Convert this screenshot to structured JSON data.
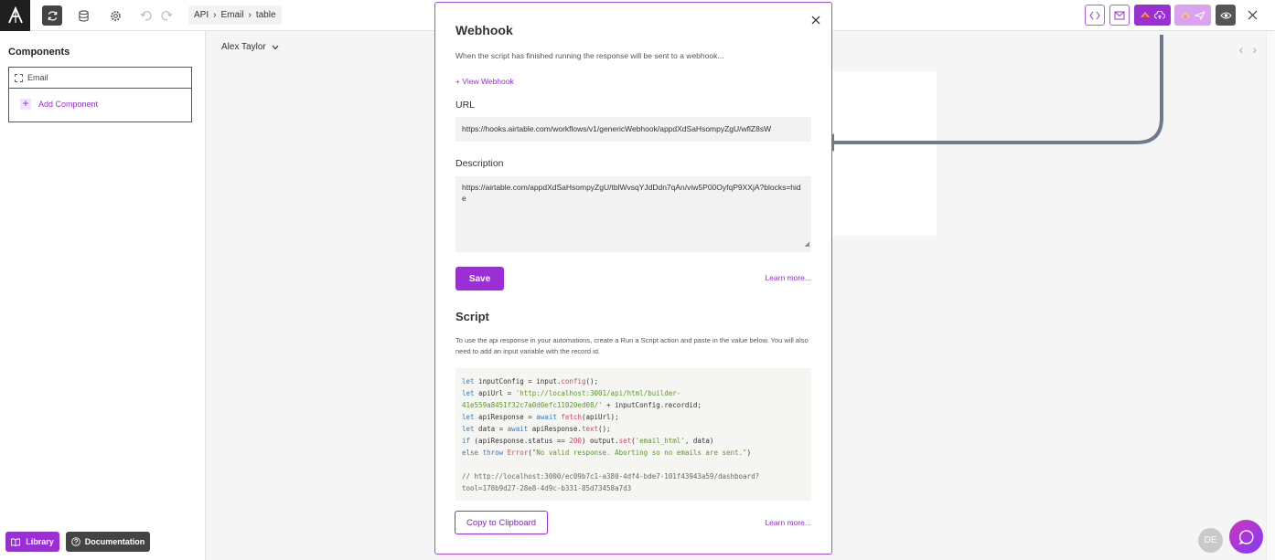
{
  "breadcrumb": [
    "API",
    "Email",
    "table"
  ],
  "sidebar": {
    "title": "Components",
    "search_value": "Email",
    "add_component": "Add Component",
    "library": "Library",
    "documentation": "Documentation"
  },
  "main": {
    "user": "Alex Taylor"
  },
  "modal": {
    "title": "Webhook",
    "subtitle": "When the script has finished running the response will be sent to a webhook...",
    "view_webhook": "+ View Webhook",
    "url_label": "URL",
    "url_value": "https://hooks.airtable.com/workflows/v1/genericWebhook/appdXdSaHsompyZgU/wflZ8sW",
    "description_label": "Description",
    "description_value": "https://airtable.com/appdXdSaHsompyZgU/tblWvsqYJdDdn7qAn/viw5P00OyfqP9XXjA?blocks=hide",
    "save": "Save",
    "learn_more": "Learn more...",
    "script_title": "Script",
    "script_desc": "To use the api response in your automations, create a Run a Script action and paste in the value below. You will also need to add an input variable with the record id.",
    "copy": "Copy to Clipboard",
    "learn_more_2": "Learn more..."
  },
  "code": {
    "c1": "http://localhost:3001/api/html/builder-",
    "c2": "41e559a8451f32c7a0d0efc11020ed08/'",
    "c3": "'email_html'",
    "c4": "\"No valid response. Aborting so no emails are sent.\"",
    "comment1": "// http://localhost:3000/ec09b7c1-a380-4df4-bde7-101f43943a59/dashboard?",
    "comment2": "tool=178b9d27-28e8-4d9c-b331-85d73458a7d3"
  },
  "avatar_initials": "DE",
  "colors": {
    "accent": "#9b2fd6",
    "dark": "#444444",
    "arrow": "#6e7b8b"
  }
}
